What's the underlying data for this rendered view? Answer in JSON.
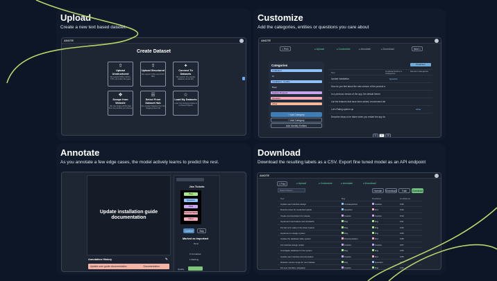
{
  "cards": {
    "upload": {
      "title": "Upload",
      "desc": "Create a new text based dataset."
    },
    "customize": {
      "title": "Customize",
      "desc": "Add the categories, entities or questions you care about"
    },
    "annotate": {
      "title": "Annotate",
      "desc": "As you annotate a few edge cases, the model  actively learns to predict the rest."
    },
    "download": {
      "title": "Download",
      "desc": "Download the resulting labels as a CSV. Export fine tuned model as an API endpoint"
    }
  },
  "app": {
    "logo": "ANOTE"
  },
  "upload_shot": {
    "heading": "Create Dataset",
    "tiles": [
      {
        "icon": "⇧",
        "title": "Upload Unstructured",
        "sub": "We support PDFs, DOCs, TXTs, and other file types"
      },
      {
        "icon": "⇧",
        "title": "Upload Structured",
        "sub": "We support CSVs and XLSX files"
      },
      {
        "icon": "✦",
        "title": "Connect To Datasets",
        "sub": "We support 10+ popular datasets via the API"
      },
      {
        "icon": "❖",
        "title": "Scrape from Website",
        "sub": "We can scrape HTML data from any website you choose"
      },
      {
        "icon": "☰",
        "title": "Select From Dataset Hub",
        "sub": "Use curated datasets from the Hugging Face hub"
      },
      {
        "icon": "☆",
        "title": "Load My Datasets",
        "sub": "Load Your Existing Datasets in Preset Projects"
      }
    ]
  },
  "customize_shot": {
    "nav": [
      "Upload",
      "Customize",
      "Annotate",
      "Download"
    ],
    "prev": "< Prev",
    "next": "Next >",
    "categories_title": "Categories",
    "categories": [
      "Unlabeled",
      "Hi",
      "Installation, Update",
      "Bugs",
      "Feature Request",
      "Question",
      "Other"
    ],
    "add_category": "+ Add Category",
    "add_ent": "+ Add Category",
    "identify": "Add Identify Entities",
    "col_text": "Text",
    "col_a": "# labeled Ethics in Categories",
    "col_b": "Mention Categories",
    "predict": "Prediction",
    "rows": [
      "Update installation",
      "How do you feel about the new version of the product and bug report",
      "In a previous version of the app, the default theme",
      "List the features that have been added, recommend ideas of that we made...",
      "Lot's Rating system up",
      "Describe steps to be taken when you restart the app for next time"
    ],
    "tags": [
      "Question",
      "",
      "",
      "",
      "Other",
      ""
    ],
    "pages": [
      "1",
      "2",
      "3"
    ]
  },
  "annotate_shot": {
    "doc": "Update installation guide documentation",
    "history_title": "Annotation History",
    "history_row": "Update user guide documentation",
    "history_tag": "Documentation",
    "label_title": "Jira Tickets",
    "labels": [
      "Bug",
      "Question",
      "Task",
      "Documentation",
      "Other"
    ],
    "confirm": "Confirm",
    "skip": "Skip",
    "marked": "Marked as Important",
    "none": "None",
    "unmarked": "0 Unmarked",
    "marking": "1 Marking",
    "quality": "Quality"
  },
  "download_shot": {
    "nav": [
      "Upload",
      "Customize",
      "Annotate",
      "Download"
    ],
    "prev": "< Prev",
    "search": "Search Rows...",
    "actions": [
      "Hannah",
      "Download",
      "Train",
      "Download"
    ],
    "cols": [
      "Text",
      "Bug",
      "Prediction",
      "Confidence"
    ],
    "rows": [
      [
        "Update user interface design",
        "Uncategorized",
        "Feature",
        "0.96"
      ],
      [
        "Resolve issue for credential update",
        "Question",
        "Doc",
        "0.93"
      ],
      [
        "Create documentation for release",
        "Feature",
        "Feature",
        "0.93"
      ],
      [
        "Implement new feature and standards",
        "Bug",
        "Bug",
        "0.91"
      ],
      [
        "Fix last error value in the ticket system",
        "Bug",
        "Bug",
        "0.90"
      ],
      [
        "Implement in design system",
        "Bug",
        "Bug",
        "0.89"
      ],
      [
        "Update the database table system",
        "Documentation",
        "Doc",
        "0.88"
      ],
      [
        "Fix interface design output",
        "Feature",
        "Feature",
        "0.87"
      ],
      [
        "Investigate database for the system",
        "Bug",
        "Bug",
        "0.86"
      ],
      [
        "Update user interface documentation",
        "Feature",
        "Doc",
        "0.85"
      ],
      [
        "Release version range for next release",
        "Bug",
        "Question",
        "0.84"
      ],
      [
        "Fix user interface navigation",
        "Feature",
        "Bug",
        "0.82"
      ]
    ]
  },
  "colors": {
    "accent": "#63d4a3",
    "pink": "#f4a8b8",
    "purple": "#c9a5f0",
    "blue": "#8fc1ff",
    "green": "#a7e889",
    "swirl": "#b9d66b"
  }
}
